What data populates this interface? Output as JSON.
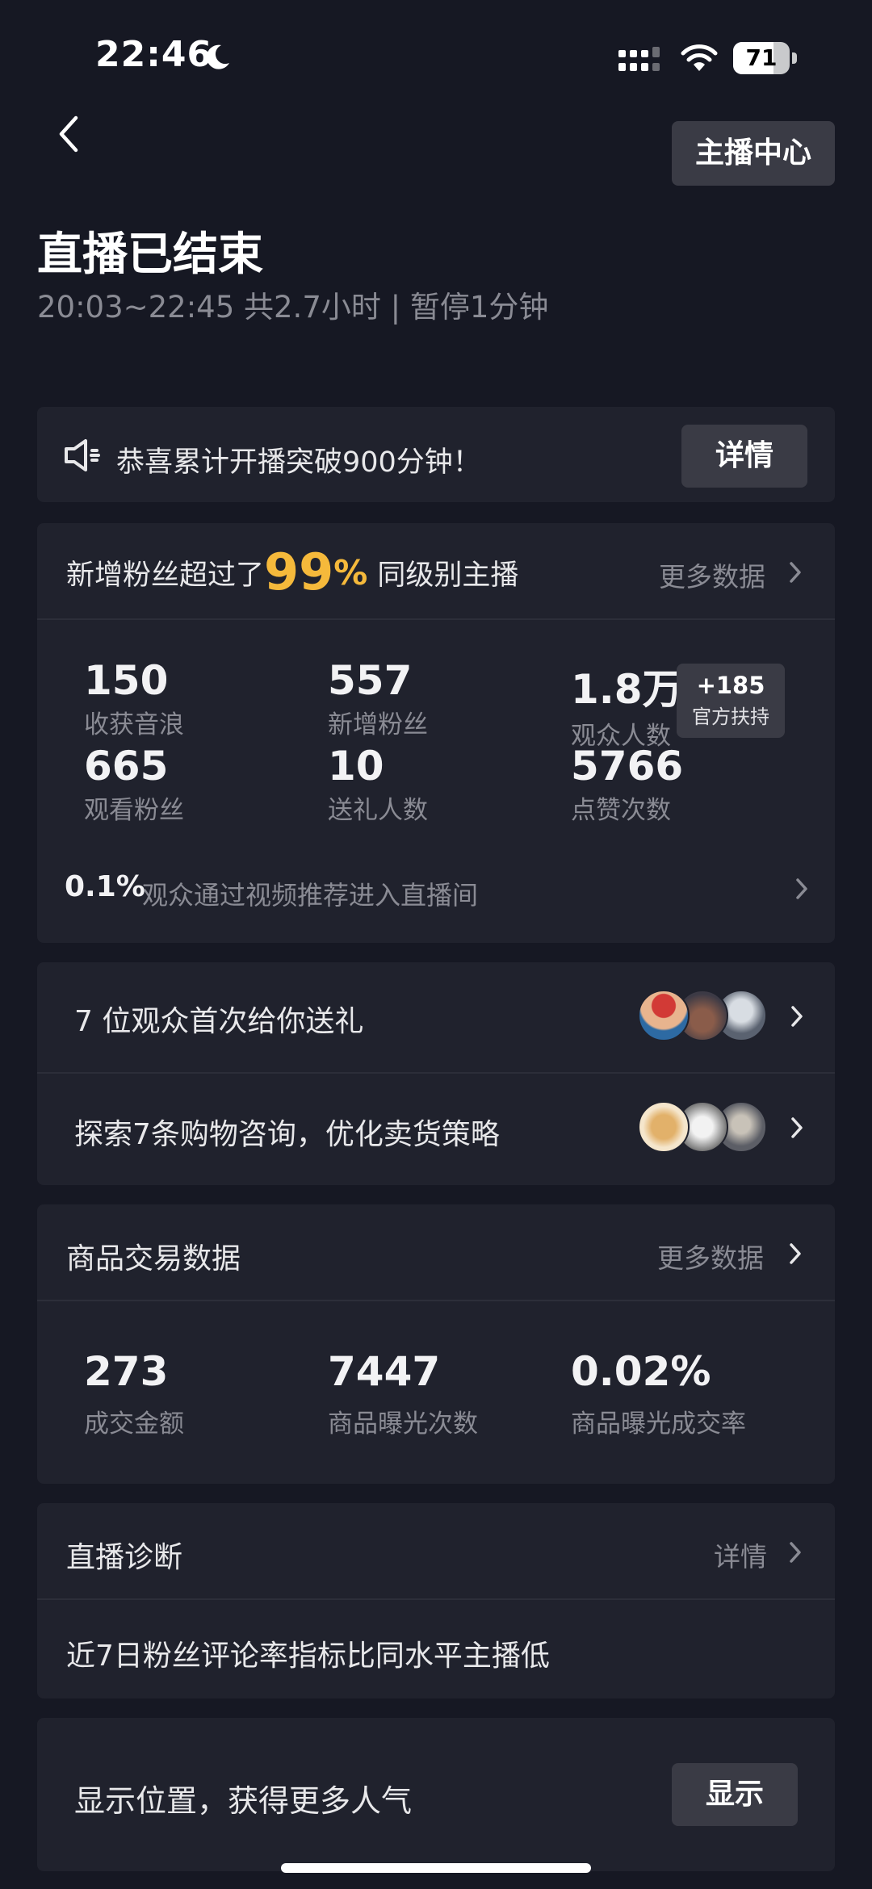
{
  "status_bar": {
    "time": "22:46",
    "battery_text": "71",
    "battery_level": 0.71,
    "icons": [
      "moon-icon",
      "signal-icon",
      "wifi-icon",
      "battery-icon"
    ]
  },
  "header": {
    "back_icon": "chevron-left-icon",
    "anchor_center_label": "主播中心",
    "title": "直播已结束",
    "subtitle": "20:03~22:45 共2.7小时 | 暂停1分钟"
  },
  "notice": {
    "icon": "speaker-icon",
    "text": "恭喜累计开播突破900分钟！",
    "detail_label": "详情"
  },
  "stats": {
    "headline_prefix": "新增粉丝超过了",
    "headline_value": "99",
    "headline_unit": "%",
    "headline_suffix": "同级别主播",
    "more_label": "更多数据",
    "items": [
      {
        "value": "150",
        "label": "收获音浪"
      },
      {
        "value": "557",
        "label": "新增粉丝"
      },
      {
        "value": "1.8万",
        "label": "观众人数"
      },
      {
        "value": "665",
        "label": "观看粉丝"
      },
      {
        "value": "10",
        "label": "送礼人数"
      },
      {
        "value": "5766",
        "label": "点赞次数"
      }
    ],
    "support_badge": {
      "value": "+185",
      "label": "官方扶持"
    },
    "footer_value": "0.1%",
    "footer_text": "观众通过视频推荐进入直播间"
  },
  "gifts": {
    "rows": [
      {
        "text": "7 位观众首次给你送礼"
      },
      {
        "text": "探索7条购物咨询，优化卖货策略"
      }
    ]
  },
  "goods": {
    "title": "商品交易数据",
    "more_label": "更多数据",
    "items": [
      {
        "value": "273",
        "label": "成交金额"
      },
      {
        "value": "7447",
        "label": "商品曝光次数"
      },
      {
        "value": "0.02%",
        "label": "商品曝光成交率"
      }
    ]
  },
  "diagnosis": {
    "title": "直播诊断",
    "detail_label": "详情",
    "text": "近7日粉丝评论率指标比同水平主播低"
  },
  "location": {
    "text": "显示位置，获得更多人气",
    "button_label": "显示"
  },
  "colors": {
    "background": "#161823",
    "card": "#20222d",
    "button": "#3a3b45",
    "accent": "#f5b93b",
    "muted_text": "#8a8b94"
  }
}
